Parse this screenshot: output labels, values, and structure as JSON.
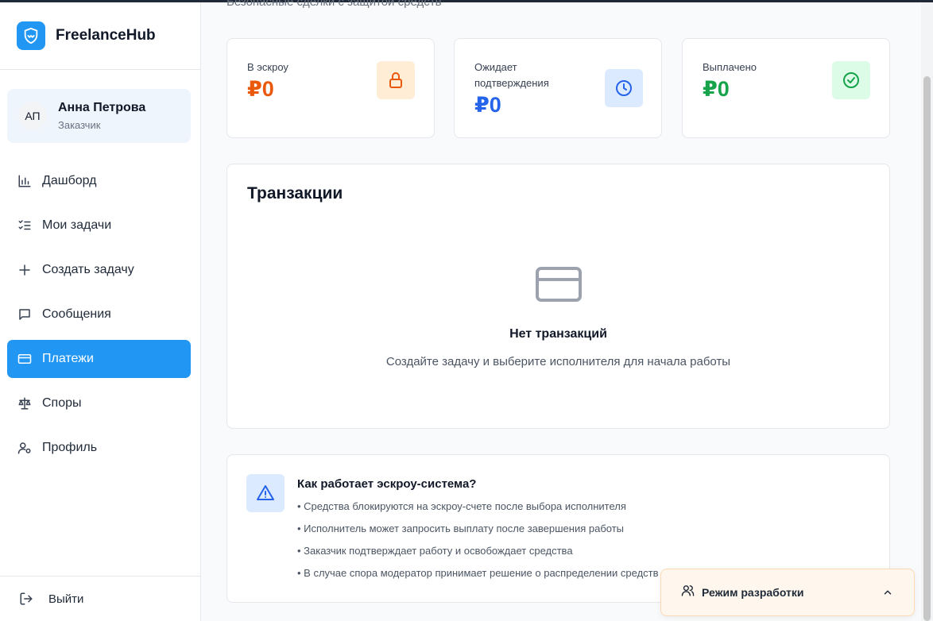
{
  "brand": {
    "name": "FreelanceHub"
  },
  "user": {
    "initials": "АП",
    "name": "Анна Петрова",
    "role": "Заказчик"
  },
  "nav": [
    {
      "label": "Дашборд",
      "icon": "bar-chart-icon",
      "active": false
    },
    {
      "label": "Мои задачи",
      "icon": "task-list-icon",
      "active": false
    },
    {
      "label": "Создать задачу",
      "icon": "plus-icon",
      "active": false
    },
    {
      "label": "Сообщения",
      "icon": "message-icon",
      "active": false
    },
    {
      "label": "Платежи",
      "icon": "credit-card-icon",
      "active": true
    },
    {
      "label": "Споры",
      "icon": "scales-icon",
      "active": false
    },
    {
      "label": "Профиль",
      "icon": "user-settings-icon",
      "active": false
    }
  ],
  "logout": {
    "label": "Выйти"
  },
  "page": {
    "subtitle": "Безопасные сделки с защитой средств"
  },
  "stats": [
    {
      "label": "В эскроу",
      "value": "₽0",
      "color": "#ea580c",
      "icon": "lock-icon",
      "icon_bg": "#ffedd5"
    },
    {
      "label": "Ожидает подтверждения",
      "value": "₽0",
      "color": "#2563eb",
      "icon": "clock-icon",
      "icon_bg": "#dbeafe"
    },
    {
      "label": "Выплачено",
      "value": "₽0",
      "color": "#16a34a",
      "icon": "check-circle-icon",
      "icon_bg": "#dcfce7"
    }
  ],
  "transactions": {
    "title": "Транзакции",
    "empty_title": "Нет транзакций",
    "empty_desc": "Создайте задачу и выберите исполнителя для начала работы"
  },
  "escrow_info": {
    "title": "Как работает эскроу-система?",
    "items": [
      "• Средства блокируются на эскроу-счете после выбора исполнителя",
      "• Исполнитель может запросить выплату после завершения работы",
      "• Заказчик подтверждает работу и освобождает средства",
      "• В случае спора модератор принимает решение о распределении средств"
    ]
  },
  "devmode": {
    "label": "Режим разработки"
  },
  "colors": {
    "accent": "#2196f3",
    "escrow": "#ea580c",
    "pending": "#2563eb",
    "paid": "#16a34a"
  }
}
